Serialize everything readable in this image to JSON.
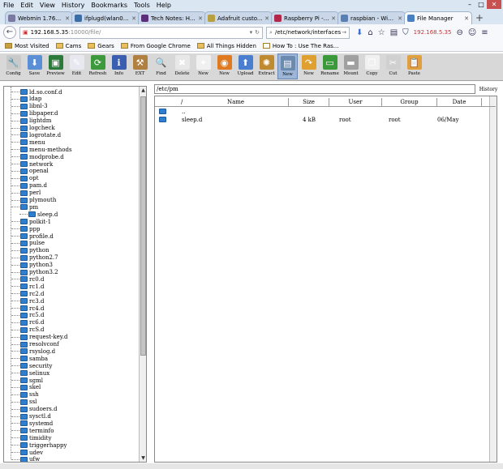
{
  "menu": [
    "File",
    "Edit",
    "View",
    "History",
    "Bookmarks",
    "Tools",
    "Help"
  ],
  "window_controls": {
    "minimize": "–",
    "maximize": "□",
    "close": "✕"
  },
  "tabs": [
    {
      "label": "Webmin 1.760 ...",
      "color": "#7a7aa0",
      "active": false
    },
    {
      "label": "ifplugd(wlan0) ...",
      "color": "#3b6ea5",
      "active": false
    },
    {
      "label": "Tech Notes: H...",
      "color": "#5a2e7a",
      "active": false
    },
    {
      "label": "Adafruit custo...",
      "color": "#b8a040",
      "active": false
    },
    {
      "label": "Raspberry Pi - ...",
      "color": "#b1284a",
      "active": false
    },
    {
      "label": "raspbian - WiFi...",
      "color": "#5b7fb0",
      "active": false
    },
    {
      "label": "File Manager",
      "color": "#4a7fc0",
      "active": true
    }
  ],
  "new_tab": "+",
  "nav": {
    "url_host": "192.168.5.35",
    "url_path": ":10000/file/",
    "search_text": "/etc/network/interfaces",
    "ip_label": "192.168.5.35"
  },
  "bookmarks": [
    "Most Visited",
    "Cams",
    "Gears",
    "From Google Chrome",
    "All Things Hidden",
    "How To : Use The Ras..."
  ],
  "toolbar": [
    {
      "label": "Config",
      "icon": "wrench-icon",
      "glyph": "🔧",
      "bg": "#c9c9c9"
    },
    {
      "label": "Save",
      "icon": "download-icon",
      "glyph": "⬇",
      "bg": "#5a8fd6"
    },
    {
      "label": "Preview",
      "icon": "preview-icon",
      "glyph": "▣",
      "bg": "#2a7a3a"
    },
    {
      "label": "Edit",
      "icon": "edit-icon",
      "glyph": "✎",
      "bg": "#e8e8f0"
    },
    {
      "label": "Refresh",
      "icon": "refresh-icon",
      "glyph": "⟳",
      "bg": "#3c9a3c"
    },
    {
      "label": "Info",
      "icon": "info-icon",
      "glyph": "ℹ",
      "bg": "#3a5fb0"
    },
    {
      "label": "EXT",
      "icon": "hammer-icon",
      "glyph": "⚒",
      "bg": "#b08040"
    },
    {
      "label": "Find",
      "icon": "find-icon",
      "glyph": "🔍",
      "bg": "#d8d8d8"
    },
    {
      "label": "Delete",
      "icon": "delete-icon",
      "glyph": "✖",
      "bg": "#e8e8e8"
    },
    {
      "label": "New",
      "icon": "new-file-icon",
      "glyph": "✦",
      "bg": "#f0f0f0"
    },
    {
      "label": "New",
      "icon": "firefox-icon",
      "glyph": "◉",
      "bg": "#e07a20"
    },
    {
      "label": "Upload",
      "icon": "upload-icon",
      "glyph": "⬆",
      "bg": "#4a7fd0"
    },
    {
      "label": "Extract",
      "icon": "extract-icon",
      "glyph": "✺",
      "bg": "#c08a30"
    },
    {
      "label": "New",
      "icon": "new-folder-icon",
      "glyph": "▤",
      "bg": "#6a8ab0"
    },
    {
      "label": "New",
      "icon": "new-link-icon",
      "glyph": "↷",
      "bg": "#e0a030"
    },
    {
      "label": "Rename",
      "icon": "rename-icon",
      "glyph": "▭",
      "bg": "#3a9a3a"
    },
    {
      "label": "Mount",
      "icon": "mount-icon",
      "glyph": "▬",
      "bg": "#a0a0a0"
    },
    {
      "label": "Copy",
      "icon": "copy-icon",
      "glyph": "❐",
      "bg": "#f0f0f0"
    },
    {
      "label": "Cut",
      "icon": "cut-icon",
      "glyph": "✂",
      "bg": "#d0d0d0"
    },
    {
      "label": "Paste",
      "icon": "paste-icon",
      "glyph": "📋",
      "bg": "#e0a040"
    }
  ],
  "tree": [
    "ld.so.conf.d",
    "ldap",
    "libnl-3",
    "libpaper.d",
    "lightdm",
    "logcheck",
    "logrotate.d",
    "menu",
    "menu-methods",
    "modprobe.d",
    "network",
    "openal",
    "opt",
    "pam.d",
    "perl",
    "plymouth",
    "pm",
    "sleep.d",
    "polkit-1",
    "ppp",
    "profile.d",
    "pulse",
    "python",
    "python2.7",
    "python3",
    "python3.2",
    "rc0.d",
    "rc1.d",
    "rc2.d",
    "rc3.d",
    "rc4.d",
    "rc5.d",
    "rc6.d",
    "rcS.d",
    "request-key.d",
    "resolvconf",
    "rsyslog.d",
    "samba",
    "security",
    "selinux",
    "sgml",
    "skel",
    "ssh",
    "ssl",
    "sudoers.d",
    "sysctl.d",
    "systemd",
    "terminfo",
    "timidity",
    "triggerhappy",
    "udev",
    "ufw"
  ],
  "path": "/etc/pm",
  "history_label": "History",
  "list": {
    "columns": [
      "/",
      "Name",
      "Size",
      "User",
      "Group",
      "Date"
    ],
    "rows": [
      {
        "name": "..",
        "size": "",
        "user": "",
        "group": "",
        "date": ""
      },
      {
        "name": "sleep.d",
        "size": "4 kB",
        "user": "root",
        "group": "root",
        "date": "06/May"
      }
    ]
  }
}
